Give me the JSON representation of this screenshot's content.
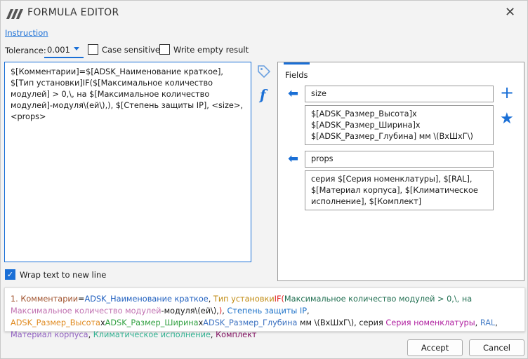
{
  "window": {
    "title": "FORMULA EDITOR"
  },
  "instruction_link": "Instruction",
  "tolerance": {
    "label": "Tolerance:",
    "value": "0.001"
  },
  "case_sensitive": {
    "label": "Case sensitive",
    "checked": false
  },
  "write_empty": {
    "label": "Write empty result",
    "checked": false
  },
  "editor_text": "$[Комментарии]=$[ADSK_Наименование краткое], $[Тип установки]IF($[Максимальное количество модулей] > 0,\\, на $[Максимальное количество модулей]-модуля\\(ей\\),), $[Степень защиты IP], <size>, <props>",
  "wrap": {
    "label": "Wrap text to new line",
    "checked": true
  },
  "fields_tab": "Fields",
  "fields": [
    {
      "name": "size",
      "value": "$[ADSK_Размер_Высота]x\n$[ADSK_Размер_Ширина]x\n$[ADSK_Размер_Глубина] мм \\(ВхШхГ\\)"
    },
    {
      "name": "props",
      "value": "серия $[Серия номенклатуры], $[RAL],\n$[Материал корпуса], $[Климатическое\nисполнение], $[Комплект]"
    }
  ],
  "preview": [
    {
      "t": "1. ",
      "c": "#a0522d"
    },
    {
      "t": "Комментарии",
      "c": "#a0522d"
    },
    {
      "t": "=",
      "c": "#1a1a1a"
    },
    {
      "t": "ADSK_Наименование краткое",
      "c": "#1f5fbf"
    },
    {
      "t": ", ",
      "c": "#1a1a1a"
    },
    {
      "t": "Тип установки",
      "c": "#c08a10"
    },
    {
      "t": "IF(",
      "c": "#e02020"
    },
    {
      "t": "Максимальное количество модулей > 0,\\, на ",
      "c": "#1f6e50"
    },
    {
      "t": "Максимальное количество модулей",
      "c": "#c070b0"
    },
    {
      "t": "-модуля\\(ей\\),",
      "c": "#1a1a1a"
    },
    {
      "t": ")",
      "c": "#e02020"
    },
    {
      "t": ", ",
      "c": "#1a1a1a"
    },
    {
      "t": "Степень защиты IP",
      "c": "#1a70c8"
    },
    {
      "t": ", ",
      "c": "#1a1a1a"
    },
    {
      "t": "ADSK_Размер_Высота",
      "c": "#e08a20"
    },
    {
      "t": "x",
      "c": "#1a1a1a"
    },
    {
      "t": "ADSK_Размер_Ширина",
      "c": "#30a040"
    },
    {
      "t": "x",
      "c": "#1a1a1a"
    },
    {
      "t": "ADSK_Размер_Глубина",
      "c": "#3a70c0"
    },
    {
      "t": " мм \\(ВхШхГ\\), серия ",
      "c": "#1a1a1a"
    },
    {
      "t": "Серия номенклатуры",
      "c": "#b020a0"
    },
    {
      "t": ", ",
      "c": "#1a1a1a"
    },
    {
      "t": "RAL",
      "c": "#4a80c8"
    },
    {
      "t": ", ",
      "c": "#1a1a1a"
    },
    {
      "t": "Материал корпуса",
      "c": "#9060c0"
    },
    {
      "t": ", ",
      "c": "#1a1a1a"
    },
    {
      "t": "Климатическое исполнение",
      "c": "#30b090"
    },
    {
      "t": ", ",
      "c": "#1a1a1a"
    },
    {
      "t": "Комплект",
      "c": "#801060"
    }
  ],
  "buttons": {
    "accept": "Accept",
    "cancel": "Cancel"
  },
  "colors": {
    "accent": "#1a6fd6"
  }
}
